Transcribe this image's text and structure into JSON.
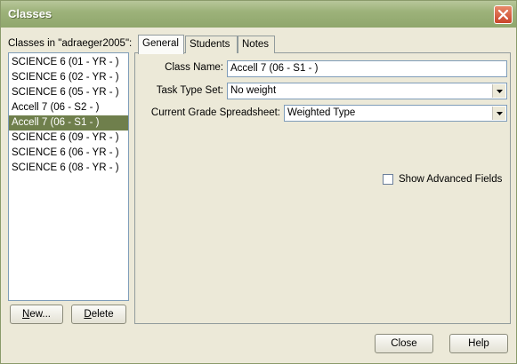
{
  "window": {
    "title": "Classes",
    "close_icon": "close-x-icon"
  },
  "class_list": {
    "caption": "Classes in \"adraeger2005\":",
    "items": [
      {
        "label": "SCIENCE 6 (01 - YR - )",
        "selected": false
      },
      {
        "label": "SCIENCE 6 (02 - YR - )",
        "selected": false
      },
      {
        "label": "SCIENCE 6 (05 - YR - )",
        "selected": false
      },
      {
        "label": "Accell 7 (06 - S2 - )",
        "selected": false
      },
      {
        "label": "Accell 7 (06 - S1 - )",
        "selected": true
      },
      {
        "label": "SCIENCE 6 (09 - YR - )",
        "selected": false
      },
      {
        "label": "SCIENCE 6 (06 - YR - )",
        "selected": false
      },
      {
        "label": "SCIENCE 6 (08 - YR - )",
        "selected": false
      }
    ],
    "new_label": "New...",
    "delete_label": "Delete"
  },
  "tabs": [
    {
      "label": "General",
      "active": true
    },
    {
      "label": "Students",
      "active": false
    },
    {
      "label": "Notes",
      "active": false
    }
  ],
  "general": {
    "class_name_label": "Class Name:",
    "class_name_value": "Accell 7 (06 - S1 - )",
    "task_type_label": "Task Type Set:",
    "task_type_value": "No weight",
    "spreadsheet_label": "Current Grade Spreadsheet:",
    "spreadsheet_value": "Weighted Type",
    "advanced_label": "Show Advanced Fields",
    "advanced_checked": false
  },
  "footer": {
    "close_label": "Close",
    "help_label": "Help"
  },
  "colors": {
    "titlebar": "#9db27a",
    "selection": "#6f7f4c",
    "face": "#ece9d8"
  }
}
